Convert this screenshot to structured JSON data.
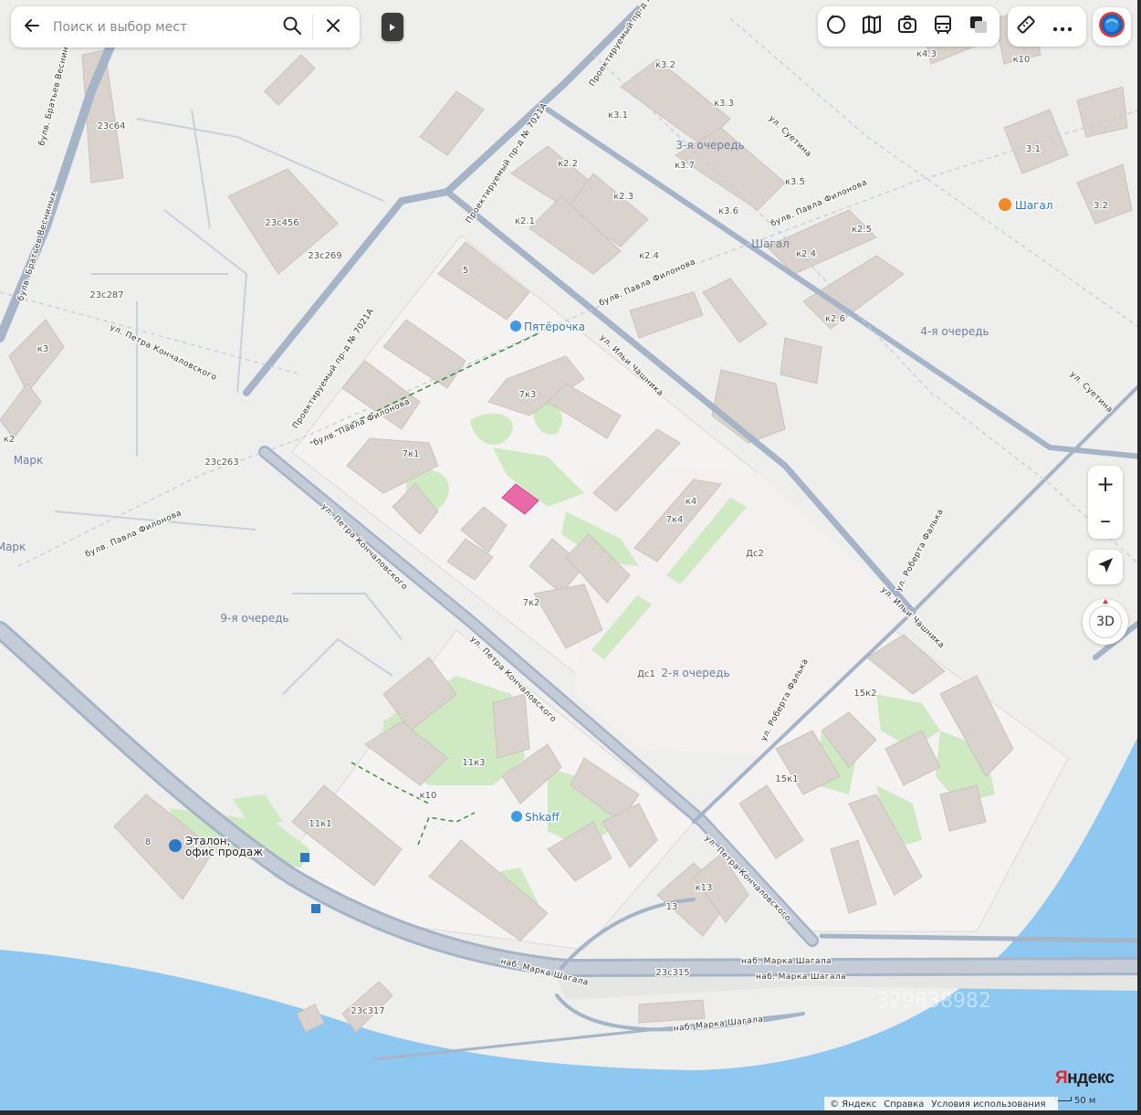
{
  "search": {
    "placeholder": "Поиск и выбор мест"
  },
  "icons": {
    "back": "arrow-left-icon",
    "search": "search-icon",
    "close": "close-icon",
    "collapse": "collapse-panel-icon",
    "tools": [
      "traffic-icon",
      "panorama-icon",
      "photo-icon",
      "transit-icon",
      "layers-icon",
      "ruler-icon",
      "more-icon"
    ],
    "globe": "globe-icon",
    "locate": "locate-me-icon"
  },
  "controls": {
    "zoom_in": "+",
    "zoom_out": "–",
    "mode_3d": "3D"
  },
  "footer": {
    "copyright": "© Яндекс",
    "help": "Справка",
    "terms": "Условия использования",
    "scale": "50 м"
  },
  "brand": {
    "first": "Я",
    "rest": "ндекс"
  },
  "colors": {
    "background": "#eeeeec",
    "block": "#f3f1ef",
    "building": "#dad3cd",
    "park": "#cfe9c3",
    "water": "#8ec8f0",
    "road": "#a5b4c6",
    "highlight": "#e86aa6"
  },
  "map": {
    "pois": [
      "Пятёрочка",
      "Шагал",
      "Shkaff",
      "Эталон,",
      "офис продаж"
    ],
    "districts": [
      "3-я очередь",
      "Шагал",
      "4-я очередь",
      "Марк",
      "9-я очередь",
      "2-я очередь",
      "Марк"
    ],
    "streets": [
      "булв. Братьев Весниных",
      "булв. Братьев Весниных",
      "ул. Петра Кончаловского",
      "Проектируемый пр-д № 7021А",
      "Проектируемый пр-д № 7021А",
      "Проектируемый пр-д № 7021А",
      "булв. Павла Филонова",
      "булв. Павла Филонова",
      "булв. Павла Филонова",
      "булв. Павла Филонова",
      "ул. Суетина",
      "ул. Суетина",
      "ул. Ильи Чашника",
      "ул. Ильи Чашника",
      "ул. Роберта Фалька",
      "ул. Роберта Фалька",
      "ул. Петра Кончаловского",
      "ул. Петра Кончаловского",
      "ул. Петра Кончаловского",
      "наб. Марка Шагала",
      "наб. Марка Шагала",
      "наб. Марка Шагала",
      "наб. Марка Шагала"
    ],
    "buildings": [
      "23с64",
      "23с456",
      "23с269",
      "23с287",
      "к3",
      "к2",
      "23с263",
      "5",
      "7к3",
      "7к1",
      "к4",
      "7к4",
      "7к2",
      "Дс2",
      "Дс1",
      "к3.2",
      "к3.3",
      "к3.1",
      "к3.7",
      "к3.5",
      "к3.6",
      "к2.2",
      "к2.3",
      "к2.1",
      "к2.4",
      "к2.5",
      "к2.4",
      "к2.6",
      "к4.3",
      "к10",
      "3.1",
      "3.2",
      "15к2",
      "15к1",
      "11к3",
      "к10",
      "11к1",
      "8",
      "к13",
      "13",
      "23с315",
      "23с317"
    ],
    "watermark": "329838982"
  }
}
